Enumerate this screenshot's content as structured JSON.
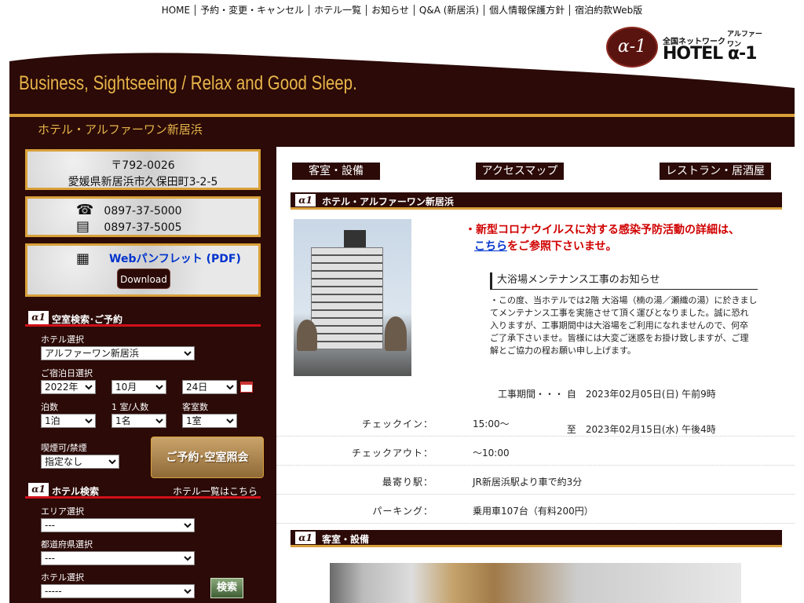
{
  "topnav": {
    "items": [
      "HOME",
      "予約・変更・キャンセル",
      "ホテル一覧",
      "お知らせ",
      "Q&A (新居浜)",
      "個人情報保護方針",
      "宿泊約款Web版"
    ]
  },
  "logo": {
    "network": "全国ネットワーク",
    "alpha_kana": "アルファーワン",
    "hotel": "HOTEL α-1"
  },
  "banner": {
    "tagline": "Business, Sightseeing / Relax and Good Sleep.",
    "hotel_name": "ホテル・アルファーワン新居浜"
  },
  "sidebar": {
    "postal": "〒792-0026",
    "address": "愛媛県新居浜市久保田町3-2-5",
    "tel": "0897-37-5000",
    "fax": "0897-37-5005",
    "pdf_label": "Webパンフレット (PDF)",
    "download": "Download",
    "booking": {
      "header": "空室検索･ご予約",
      "hotel_label": "ホテル選択",
      "hotel_value": "アルファーワン新居浜",
      "date_label": "ご宿泊日選択",
      "year": "2022年",
      "month": "10月",
      "day": "24日",
      "nights_label": "泊数",
      "nights": "1泊",
      "persons_label": "1 室/人数",
      "persons": "1名",
      "rooms_label": "客室数",
      "rooms": "1室",
      "smoking_label": "喫煙可/禁煙",
      "smoking": "指定なし",
      "reserve_btn": "ご予約･空室照会"
    },
    "search": {
      "header": "ホテル検索",
      "list_link": "ホテル一覧はこちら",
      "area_label": "エリア選択",
      "area": "---",
      "pref_label": "都道府県選択",
      "pref": "---",
      "hotel_label": "ホテル選択",
      "hotel": "-----",
      "search_btn": "検索"
    }
  },
  "main": {
    "tabs": [
      "客室・設備",
      "アクセスマップ",
      "レストラン・居酒屋"
    ],
    "section1": "ホテル・アルファーワン新居浜",
    "notice_line1": "・新型コロナウイルスに対する感染予防活動の詳細は、",
    "notice_link": "こちら",
    "notice_line2": "をご参照下さいませ。",
    "maint_title": "大浴場メンテナンス工事のお知らせ",
    "maint_body": [
      "・この度、当ホテルでは2階 大浴場（楠の湯／瀬織の湯）に於きまし",
      "てメンテナンス工事を実施させて頂く運びとなりました。誠に恐れ",
      "入りますが、工事期間中は大浴場をご利用になれませんので、何卒",
      "ご了承下さいませ。皆様には大変ご迷惑をお掛け致しますが、ご理",
      "解とご協力の程お願い申し上げます。"
    ],
    "maint_period1": "工事期間・・・ 自　2023年02月05日(日) 午前9時",
    "maint_period2": "　　　　　　　 至　2023年02月15日(水) 午後4時",
    "info": [
      {
        "k": "チェックイン：",
        "v": "15:00〜"
      },
      {
        "k": "チェックアウト：",
        "v": "〜10:00"
      },
      {
        "k": "最寄り駅：",
        "v": "JR新居浜駅より車で約3分"
      },
      {
        "k": "パーキング：",
        "v": "乗用車107台（有料200円）"
      }
    ],
    "section2": "客室・設備"
  },
  "colors": {
    "dark_brown": "#2b0a07",
    "gold": "#d9a03a",
    "red_line": "#d0101a",
    "notice_red": "#d00000",
    "link_blue": "#0033cc"
  }
}
